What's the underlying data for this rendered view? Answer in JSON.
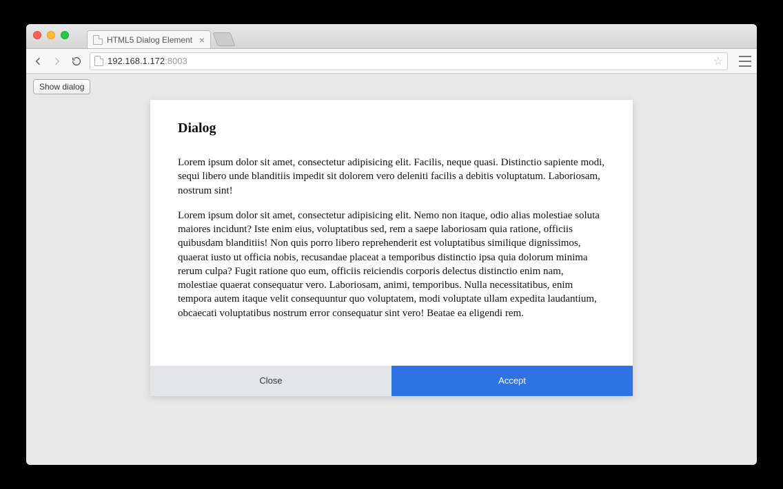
{
  "browser": {
    "tab_title": "HTML5 Dialog Element",
    "url_host": "192.168.1.172",
    "url_port": ":8003"
  },
  "page": {
    "show_dialog_label": "Show dialog"
  },
  "dialog": {
    "title": "Dialog",
    "paragraph1": "Lorem ipsum dolor sit amet, consectetur adipisicing elit. Facilis, neque quasi. Distinctio sapiente modi, sequi libero unde blanditiis impedit sit dolorem vero deleniti facilis a debitis voluptatum. Laboriosam, nostrum sint!",
    "paragraph2": "Lorem ipsum dolor sit amet, consectetur adipisicing elit. Nemo non itaque, odio alias molestiae soluta maiores incidunt? Iste enim eius, voluptatibus sed, rem a saepe laboriosam quia ratione, officiis quibusdam blanditiis! Non quis porro libero reprehenderit est voluptatibus similique dignissimos, quaerat iusto ut officia nobis, recusandae placeat a temporibus distinctio ipsa quia dolorum minima rerum culpa? Fugit ratione quo eum, officiis reiciendis corporis delectus distinctio enim nam, molestiae quaerat consequatur vero. Laboriosam, animi, temporibus. Nulla necessitatibus, enim tempora autem itaque velit consequuntur quo voluptatem, modi voluptate ullam expedita laudantium, obcaecati voluptatibus nostrum error consequatur sint vero! Beatae ea eligendi rem.",
    "close_label": "Close",
    "accept_label": "Accept"
  }
}
